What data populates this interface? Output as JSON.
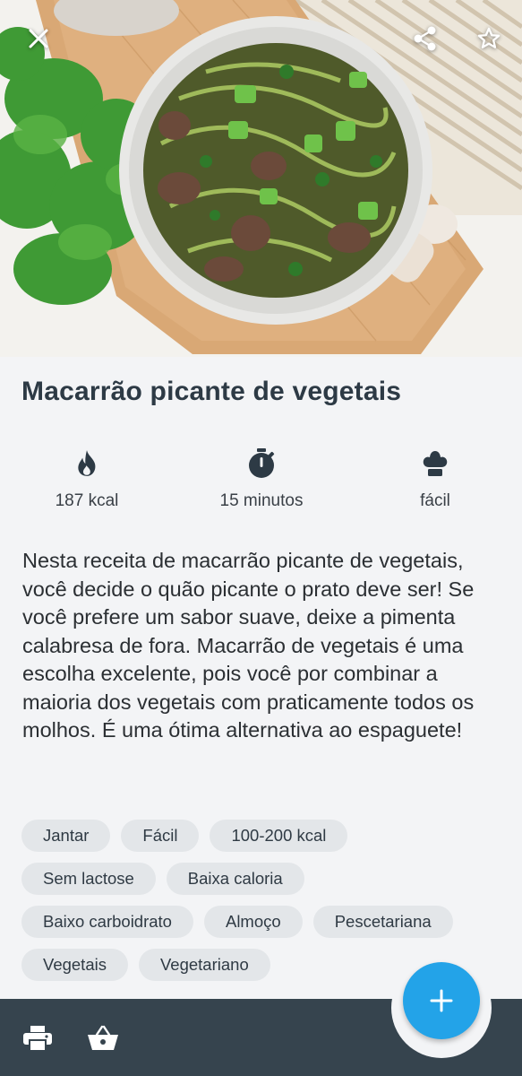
{
  "recipe": {
    "title": "Macarrão picante de vegetais",
    "description": "Nesta receita de macarrão picante de vegetais, você decide o quão picante o prato deve ser! Se você prefere um sabor suave, deixe a pimenta calabresa de fora. Macarrão de vegetais é uma escolha excelente, pois você por combinar a maioria dos vegetais com praticamente todos os molhos. É uma ótima alternativa ao espaguete!"
  },
  "stats": {
    "calories": "187 kcal",
    "time": "15 minutos",
    "difficulty": "fácil"
  },
  "tags": [
    [
      "Jantar",
      "Fácil",
      "100-200 kcal"
    ],
    [
      "Sem lactose",
      "Baixa caloria"
    ],
    [
      "Baixo carboidrato",
      "Almoço",
      "Pescetariana"
    ],
    [
      "Vegetais",
      "Vegetariano"
    ]
  ],
  "icons": {
    "close": "close-icon",
    "share": "share-icon",
    "favorite": "star-outline-icon",
    "calories": "flame-icon",
    "time": "stopwatch-icon",
    "difficulty": "chef-hat-icon",
    "print": "printer-icon",
    "shopping": "basket-icon",
    "add": "plus-icon"
  },
  "colors": {
    "accent": "#23a3e8",
    "bottom_bar": "#36444e",
    "tag_bg": "#e3e6e9",
    "title": "#2d3a45"
  }
}
